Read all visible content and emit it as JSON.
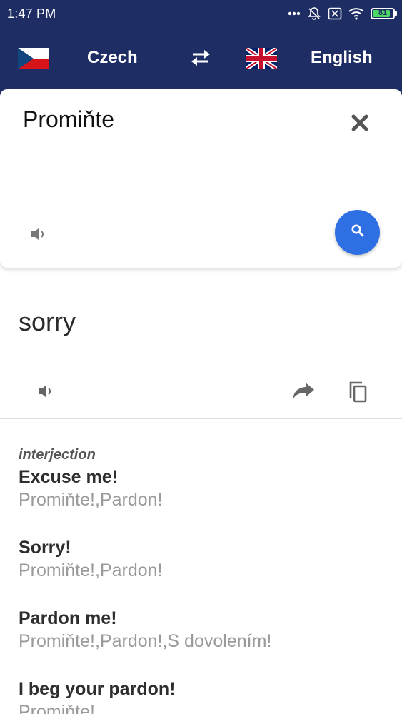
{
  "status_bar": {
    "time": "1:47 PM",
    "battery": "81",
    "battery_level": 0.81
  },
  "header": {
    "source_language": "Czech",
    "target_language": "English",
    "source_flag": "czech-flag-icon",
    "target_flag": "uk-flag-icon",
    "swap_icon": "swap-arrows-icon",
    "background_color": "#1e2e64"
  },
  "input": {
    "text": "Promiňte",
    "clear_icon": "close-icon",
    "speaker_icon": "speaker-icon",
    "search_icon": "search-icon",
    "search_button_color": "#2f6fe4"
  },
  "translation": {
    "text": "sorry",
    "speaker_icon": "speaker-icon",
    "share_icon": "share-icon",
    "copy_icon": "copy-icon"
  },
  "dictionary": {
    "part_of_speech": "interjection",
    "entries": [
      {
        "term": "Excuse me!",
        "synonyms": "Promiňte!,Pardon!"
      },
      {
        "term": "Sorry!",
        "synonyms": "Promiňte!,Pardon!"
      },
      {
        "term": "Pardon me!",
        "synonyms": "Promiňte!,Pardon!,S dovolením!"
      },
      {
        "term": "I beg your pardon!",
        "synonyms": "Promiňte!"
      }
    ]
  }
}
